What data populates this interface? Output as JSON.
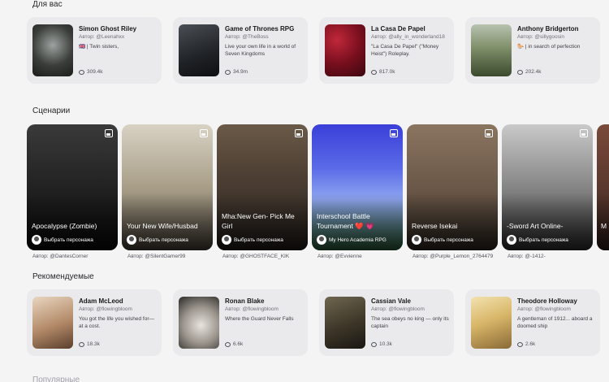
{
  "sections": {
    "for_you": "Для вас",
    "scenarios": "Сценарии",
    "recommended": "Рекомендуемые",
    "next": "Популярные"
  },
  "for_you": [
    {
      "name": "Simon Ghost Riley",
      "author": "Автор: @Leenahxx",
      "desc": "🇬🇧 | Twin sisters,",
      "count": "309.4k"
    },
    {
      "name": "Game of Thrones RPG",
      "author": "Автор: @TheBoss",
      "desc": "Live your own life in a world of Seven Kingdoms",
      "count": "34.9m"
    },
    {
      "name": "La Casa De Papel",
      "author": "Автор: @ally_in_wonderland18",
      "desc": "\"La Casa De Papel\" (\"Money Heist\") Roleplay.",
      "count": "817.0k"
    },
    {
      "name": "Anthony Bridgerton",
      "author": "Автор: @sillygoosin",
      "desc": "🐎 | in search of perfection",
      "count": "202.4k"
    }
  ],
  "scenarios": [
    {
      "title": "Apocalypse (Zombie)",
      "pick": "Выбрать персонажа",
      "author": "Автор: @DantesCorner"
    },
    {
      "title": "Your New Wife/Husbad",
      "pick": "Выбрать персонажа",
      "author": "Автор: @SilentGamer99"
    },
    {
      "title": "Mha:New Gen- Pick Me Girl",
      "pick": "Выбрать персонажа",
      "author": "Автор: @GHOSTFACE_KIK"
    },
    {
      "title": "Interschool Battle Tournament ❤️ 💗",
      "pick": "My Hero Academia RPG",
      "author": "Автор: @Evvienne"
    },
    {
      "title": "Reverse Isekai",
      "pick": "Выбрать персонажа",
      "author": "Автор: @Purple_Lemon_2764479"
    },
    {
      "title": "-Sword Art Online-",
      "pick": "Выбрать персонажа",
      "author": "Автор: @-1412-"
    },
    {
      "title": "M",
      "pick": "",
      "author": ""
    }
  ],
  "recommended": [
    {
      "name": "Adam McLeod",
      "author": "Автор: @flowingbloom",
      "desc": "You got the life you wished for— at a cost.",
      "count": "18.3k"
    },
    {
      "name": "Ronan Blake",
      "author": "Автор: @flowingbloom",
      "desc": "Where the Guard Never Falls",
      "count": "6.6k"
    },
    {
      "name": "Cassian Vale",
      "author": "Автор: @flowingbloom",
      "desc": "The sea obeys no king — only its captain",
      "count": "10.3k"
    },
    {
      "name": "Theodore Holloway",
      "author": "Автор: @flowingbloom",
      "desc": "A gentleman of 1912... aboard a doomed ship",
      "count": "2.6k"
    }
  ]
}
